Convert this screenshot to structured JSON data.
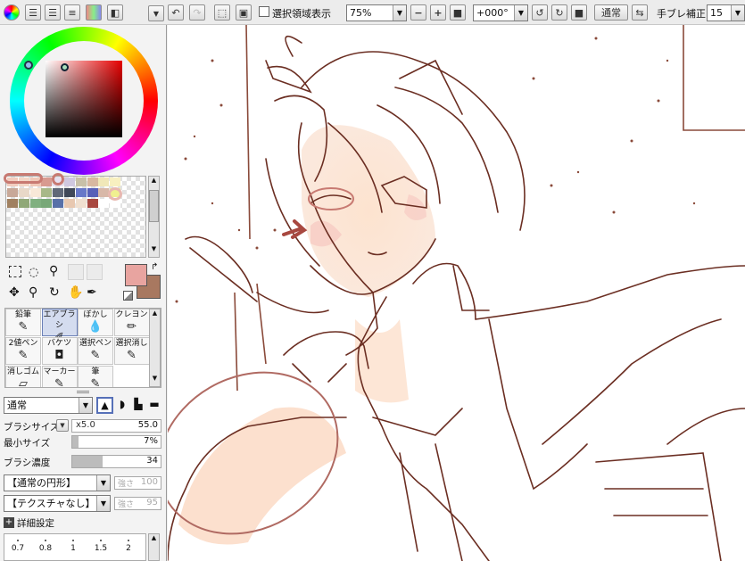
{
  "toolbar": {
    "selection_display_label": "選択領域表示",
    "zoom_value": "75%",
    "rotation_value": "+000°",
    "blend_mode": "通常",
    "stabilizer_label": "手ブレ補正",
    "stabilizer_value": "15"
  },
  "brush": {
    "mode": "通常",
    "size_label": "ブラシサイズ",
    "size_multiplier": "x5.0",
    "size_value": "55.0",
    "min_size_label": "最小サイズ",
    "min_size_value": "7%",
    "min_size_fraction": 0.07,
    "density_label": "ブラシ濃度",
    "density_value": "34",
    "density_fraction": 0.34,
    "shape_value": "【通常の円形】",
    "shape_strength_label": "強さ",
    "shape_strength_value": "100",
    "texture_value": "【テクスチャなし】",
    "texture_strength_label": "強さ",
    "texture_strength_value": "95",
    "advanced_label": "詳細設定",
    "presets": [
      "0.7",
      "0.8",
      "1",
      "1.5",
      "2"
    ]
  },
  "tools": [
    {
      "label": "鉛筆",
      "icon": "pencil-icon",
      "glyph": "✎"
    },
    {
      "label": "エアブラシ",
      "icon": "airbrush-icon",
      "glyph": "✐"
    },
    {
      "label": "ぼかし",
      "icon": "blur-icon",
      "glyph": "💧"
    },
    {
      "label": "クレヨン",
      "icon": "crayon-icon",
      "glyph": "✏"
    },
    {
      "label": "2値ペン",
      "icon": "binary-pen-icon",
      "glyph": "✎"
    },
    {
      "label": "バケツ",
      "icon": "bucket-icon",
      "glyph": "◘"
    },
    {
      "label": "選択ペン",
      "icon": "select-pen-icon",
      "glyph": "✎"
    },
    {
      "label": "選択消し",
      "icon": "select-erase-icon",
      "glyph": "✎"
    },
    {
      "label": "消しゴム",
      "icon": "eraser-icon",
      "glyph": "▱"
    },
    {
      "label": "マーカー",
      "icon": "marker-icon",
      "glyph": "✎"
    },
    {
      "label": "筆",
      "icon": "brush-icon",
      "glyph": "✎"
    }
  ],
  "colors": {
    "primary": "#e8a4a0",
    "secondary": "#a87860",
    "swatches": [
      "#f2cdbf",
      "#f3d6c6",
      "#f0c8b8",
      "#d89a90",
      "#e8e0f0",
      "#d0c8e0",
      "#c8c0a8",
      "#d8b8a0",
      "#f0e8b8",
      "#f8f0c0",
      "#c8a898",
      "#e8d8c8",
      "#f8e8d8",
      "#a8b888",
      "#606878",
      "#404858",
      "#6878c8",
      "#5860b8",
      "#d8b8a8",
      "#f0f090",
      "#a08060",
      "#90a878",
      "#80b080",
      "#78a878",
      "#5870a8",
      "#e8c8b0",
      "#f0e0d0",
      "#a84840",
      "#ffffff",
      "#ffffff"
    ]
  }
}
